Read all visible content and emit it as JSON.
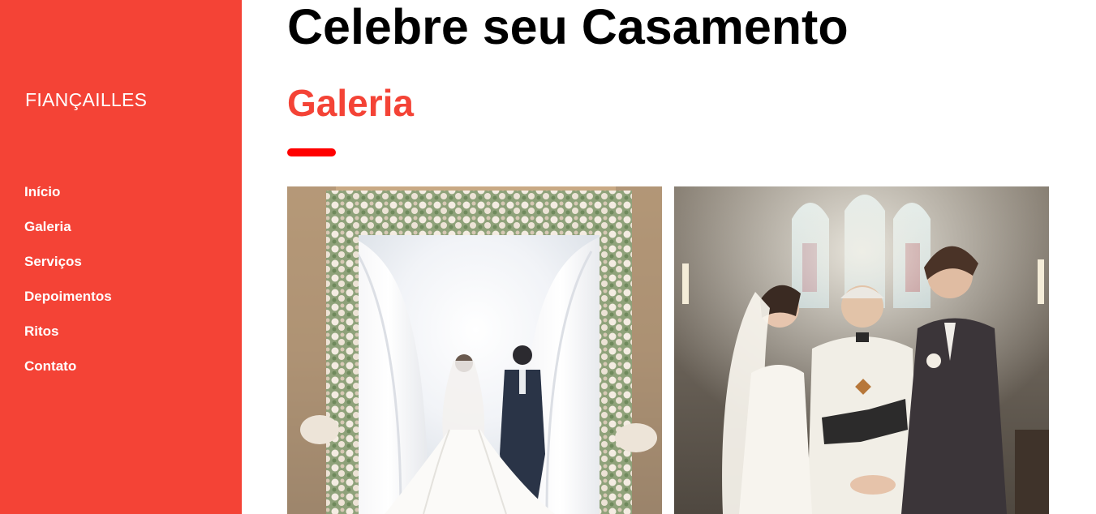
{
  "sidebar": {
    "brand": "FIANÇAILLES",
    "items": [
      {
        "label": "Início"
      },
      {
        "label": "Galeria"
      },
      {
        "label": "Serviços"
      },
      {
        "label": "Depoimentos"
      },
      {
        "label": "Ritos"
      },
      {
        "label": "Contato"
      }
    ]
  },
  "main": {
    "title": "Celebre seu Casamento",
    "section_title": "Galeria"
  },
  "colors": {
    "accent": "#f44336",
    "divider": "#ff0000"
  },
  "gallery": {
    "images": [
      {
        "icon": "floral-arch-wedding-photo"
      },
      {
        "icon": "church-ceremony-photo"
      }
    ]
  }
}
